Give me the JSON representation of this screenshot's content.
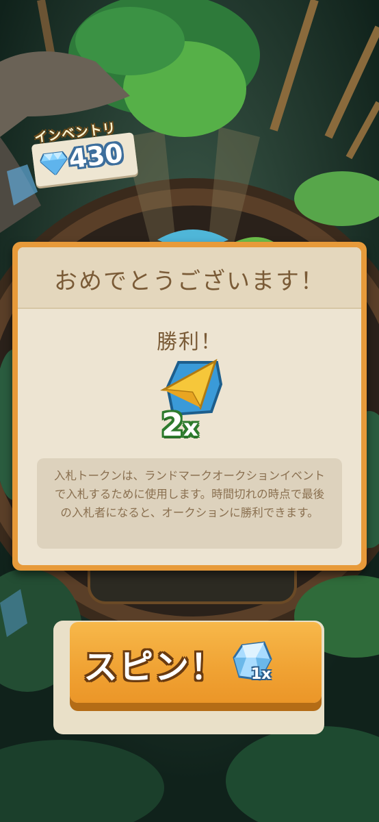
{
  "inventory": {
    "label": "インベントリ",
    "count": "430",
    "icon": "diamond-icon"
  },
  "modal": {
    "title": "おめでとうございます！",
    "result": "勝利！",
    "reward": {
      "icon": "bid-token-icon",
      "multiplier_number": "2",
      "multiplier_x": "x"
    },
    "description": "入札トークンは、ランドマークオークションイベントで入札するために使用します。時間切れの時点で最後の入札者になると、オークションに勝利できます。"
  },
  "spin_button": {
    "label": "スピン！",
    "cost": "1x",
    "cost_icon": "diamond-icon"
  },
  "colors": {
    "modal_border": "#e79a3a",
    "modal_bg": "#ede4d2",
    "title_text": "#7a5b37",
    "spin_button": "#f0a233",
    "multiplier_outline": "#2d7a2c"
  }
}
